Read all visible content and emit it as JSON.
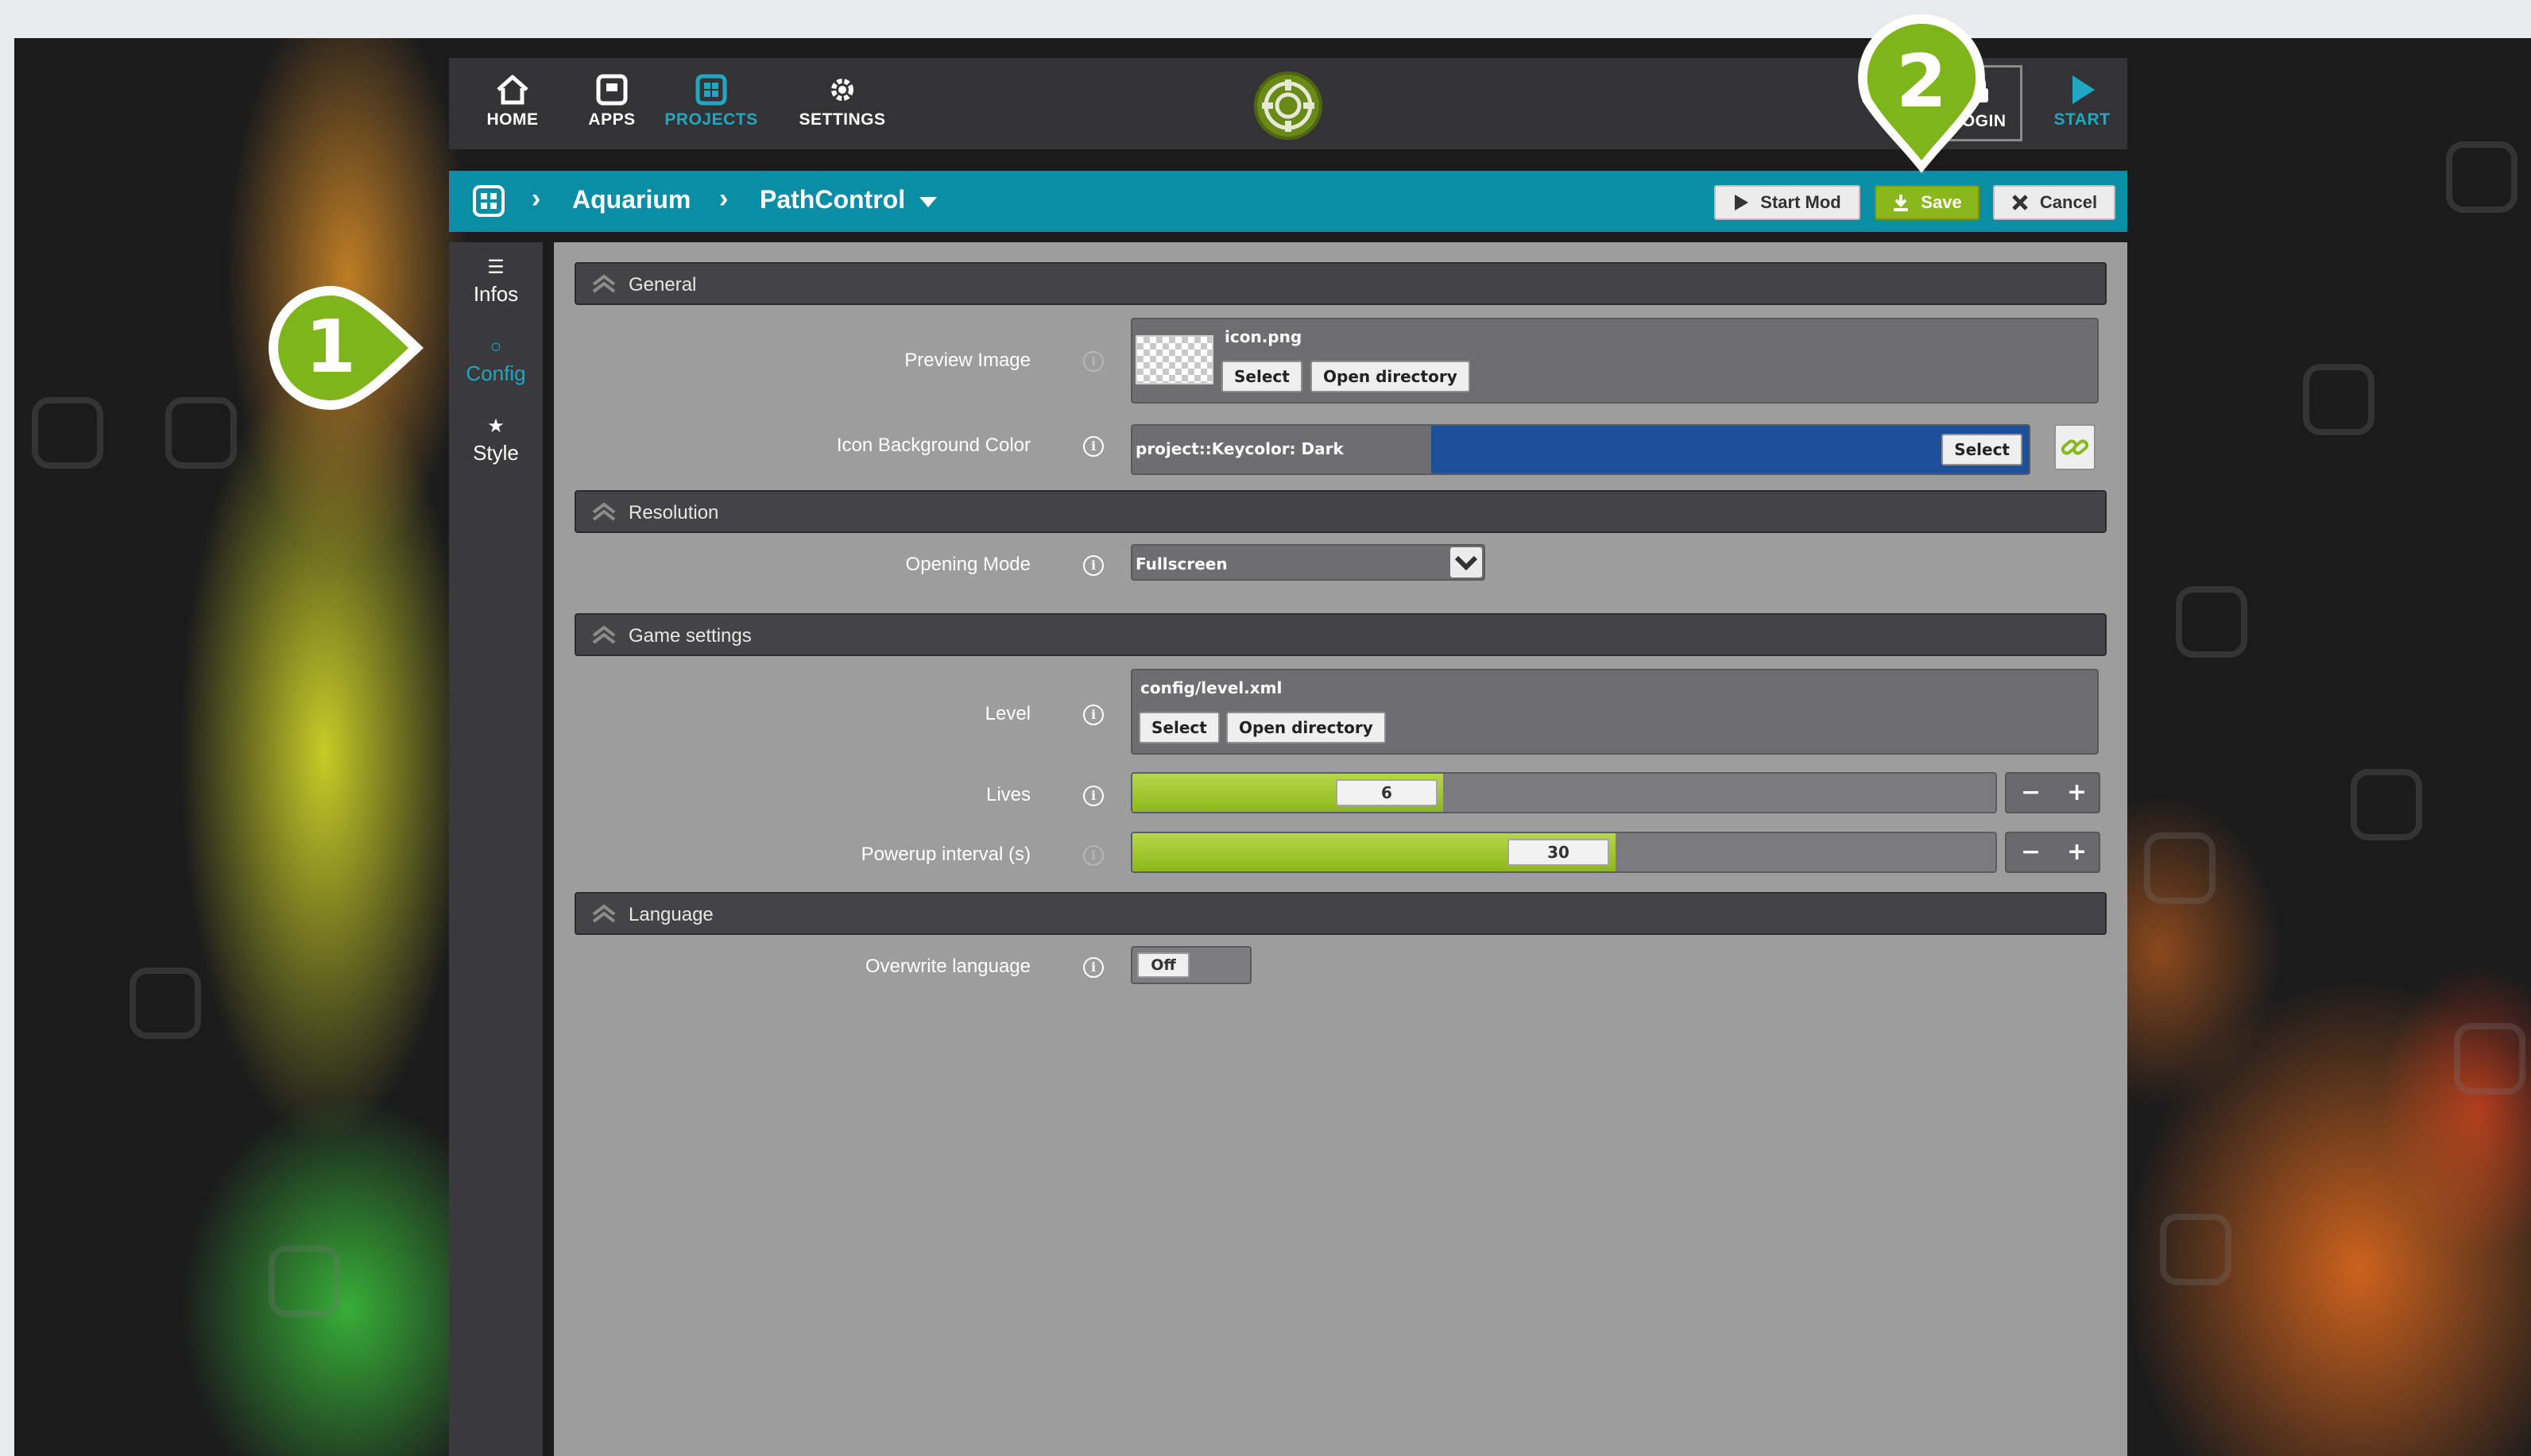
{
  "nav": {
    "items": [
      {
        "label": "HOME",
        "icon": "home-icon"
      },
      {
        "label": "APPS",
        "icon": "apps-icon"
      },
      {
        "label": "PROJECTS",
        "icon": "projects-icon",
        "active": true
      },
      {
        "label": "SETTINGS",
        "icon": "gear-icon"
      }
    ],
    "login_label": "LOGIN",
    "start_label": "START"
  },
  "breadcrumb": {
    "project": "Aquarium",
    "module": "PathControl"
  },
  "toolbar": {
    "start_mod": "Start Mod",
    "save": "Save",
    "cancel": "Cancel"
  },
  "sidebar": {
    "items": [
      {
        "label": "Infos",
        "glyph": "list-icon"
      },
      {
        "label": "Config",
        "glyph": "circle-icon",
        "active": true
      },
      {
        "label": "Style",
        "glyph": "star-icon"
      }
    ]
  },
  "sections": {
    "general": "General",
    "resolution": "Resolution",
    "game_settings": "Game settings",
    "language": "Language"
  },
  "fields": {
    "preview_image": {
      "label": "Preview Image",
      "file": "icon.png",
      "select": "Select",
      "open_directory": "Open directory"
    },
    "icon_bg_color": {
      "label": "Icon Background Color",
      "value": "project::Keycolor: Dark",
      "color": "#1e4f99",
      "select": "Select"
    },
    "opening_mode": {
      "label": "Opening Mode",
      "value": "Fullscreen"
    },
    "level": {
      "label": "Level",
      "file": "config/level.xml",
      "select": "Select",
      "open_directory": "Open directory"
    },
    "lives": {
      "label": "Lives",
      "value": "6",
      "fill_fraction": 0.36
    },
    "powerup_interval": {
      "label": "Powerup interval (s)",
      "value": "30",
      "fill_fraction": 0.56
    },
    "overwrite_language": {
      "label": "Overwrite language",
      "value": "Off"
    }
  },
  "stepper": {
    "minus": "−",
    "plus": "+"
  },
  "callouts": [
    "1",
    "2"
  ],
  "colors": {
    "accent_teal": "#0a8ea6",
    "accent_green": "#8ab81c",
    "callout_green": "#7fb51a"
  }
}
